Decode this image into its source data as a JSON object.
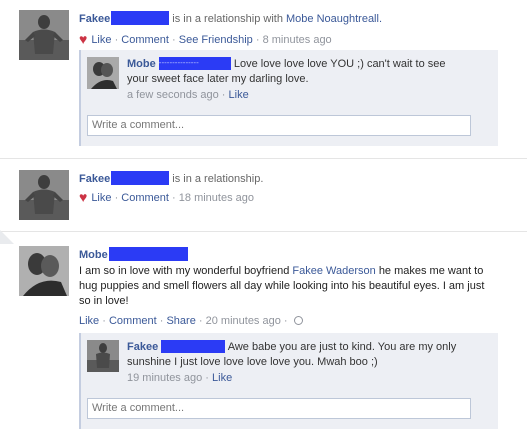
{
  "story1": {
    "name": "Fakee",
    "action": "is in a relationship with",
    "partner": "Mobe Noaughtreall.",
    "like": "Like",
    "comment": "Comment",
    "see_friendship": "See Friendship",
    "time": "8 minutes ago",
    "reply": {
      "name": "Mobe",
      "redact_dashes": "---------------",
      "text": "Love love love love YOU ;) can't wait to see your sweet face later my darling love.",
      "time": "a few seconds ago",
      "like": "Like"
    },
    "write_placeholder": "Write a comment..."
  },
  "story2": {
    "name": "Fakee",
    "action": "is in a relationship.",
    "like": "Like",
    "comment": "Comment",
    "time": "18 minutes ago"
  },
  "story3": {
    "name": "Mobe",
    "text_before": "I am so in love with my wonderful boyfriend",
    "mention": "Fakee Waderson",
    "text_after": "he makes me want to hug puppies and smell flowers all day while looking into his beautiful eyes. I am just so in love!",
    "like": "Like",
    "comment": "Comment",
    "share": "Share",
    "time": "20 minutes ago",
    "reply": {
      "name": "Fakee",
      "text": "Awe babe you are just to kind. You are my only sunshine I just love love love love you. Mwah boo ;)",
      "time": "19 minutes ago",
      "like": "Like"
    },
    "write_placeholder": "Write a comment..."
  },
  "separator": "·",
  "colors": {
    "link": "#3b5998",
    "redaction": "#2b3bf5",
    "heart": "#cc3344"
  }
}
